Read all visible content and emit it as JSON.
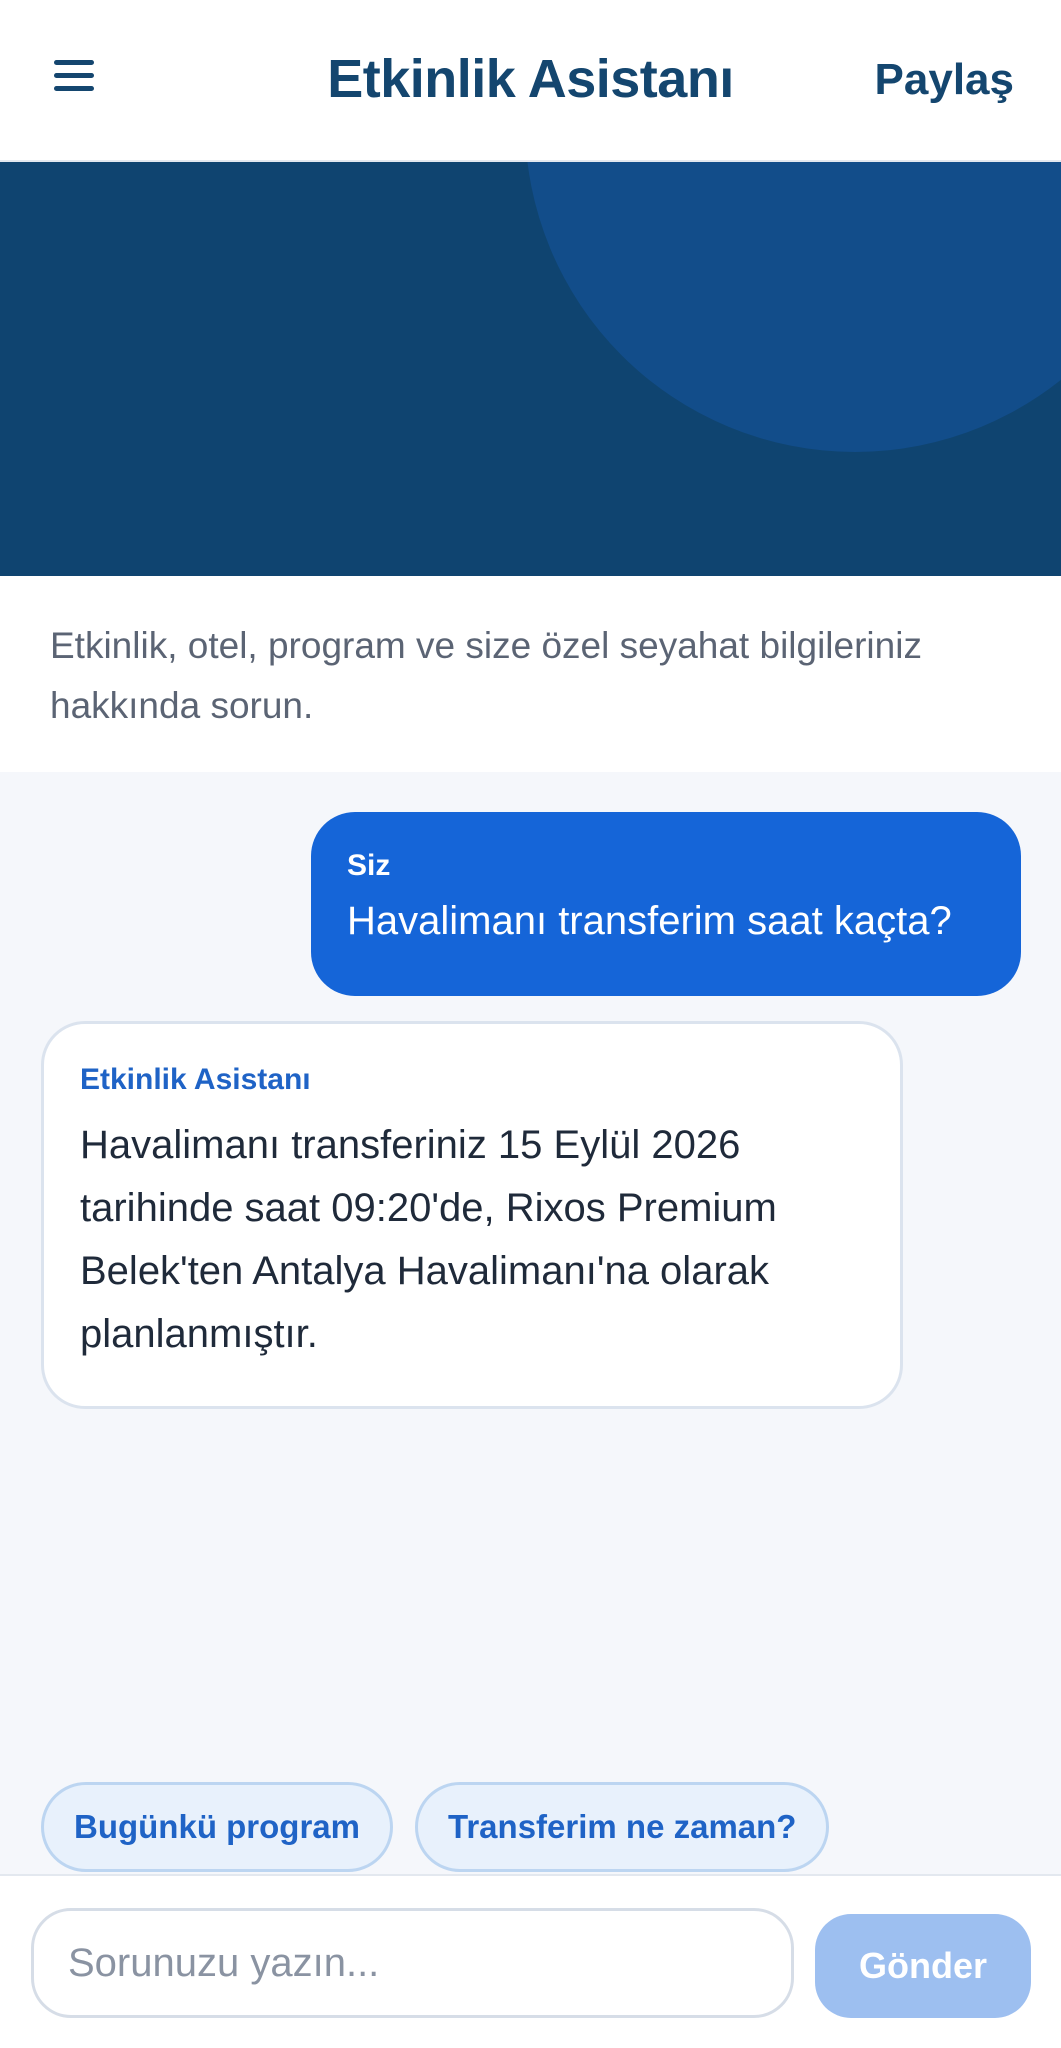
{
  "header": {
    "title": "Etkinlik Asistanı",
    "share_label": "Paylaş",
    "menu_icon": "hamburger-menu-icon"
  },
  "colors": {
    "brand": "#14466f",
    "hero": "#0f4470",
    "accent": "#1565d8"
  },
  "intro": {
    "text": "Etkinlik, otel, program ve size özel seyahat bilgileriniz hakkında sorun."
  },
  "messages": [
    {
      "role": "user",
      "sender": "Siz",
      "text": "Havalimanı transferim saat kaçta?"
    },
    {
      "role": "assistant",
      "sender": "Etkinlik Asistanı",
      "text": "Havalimanı transferiniz 15 Eylül 2026 tarihinde saat 09:20'de, Rixos Premium Belek'ten Antalya Havalimanı'na olarak planlanmıştır."
    }
  ],
  "suggestions": [
    "Bugünkü program",
    "Transferim ne zaman?"
  ],
  "composer": {
    "placeholder": "Sorunuzu yazın...",
    "send_label": "Gönder"
  }
}
